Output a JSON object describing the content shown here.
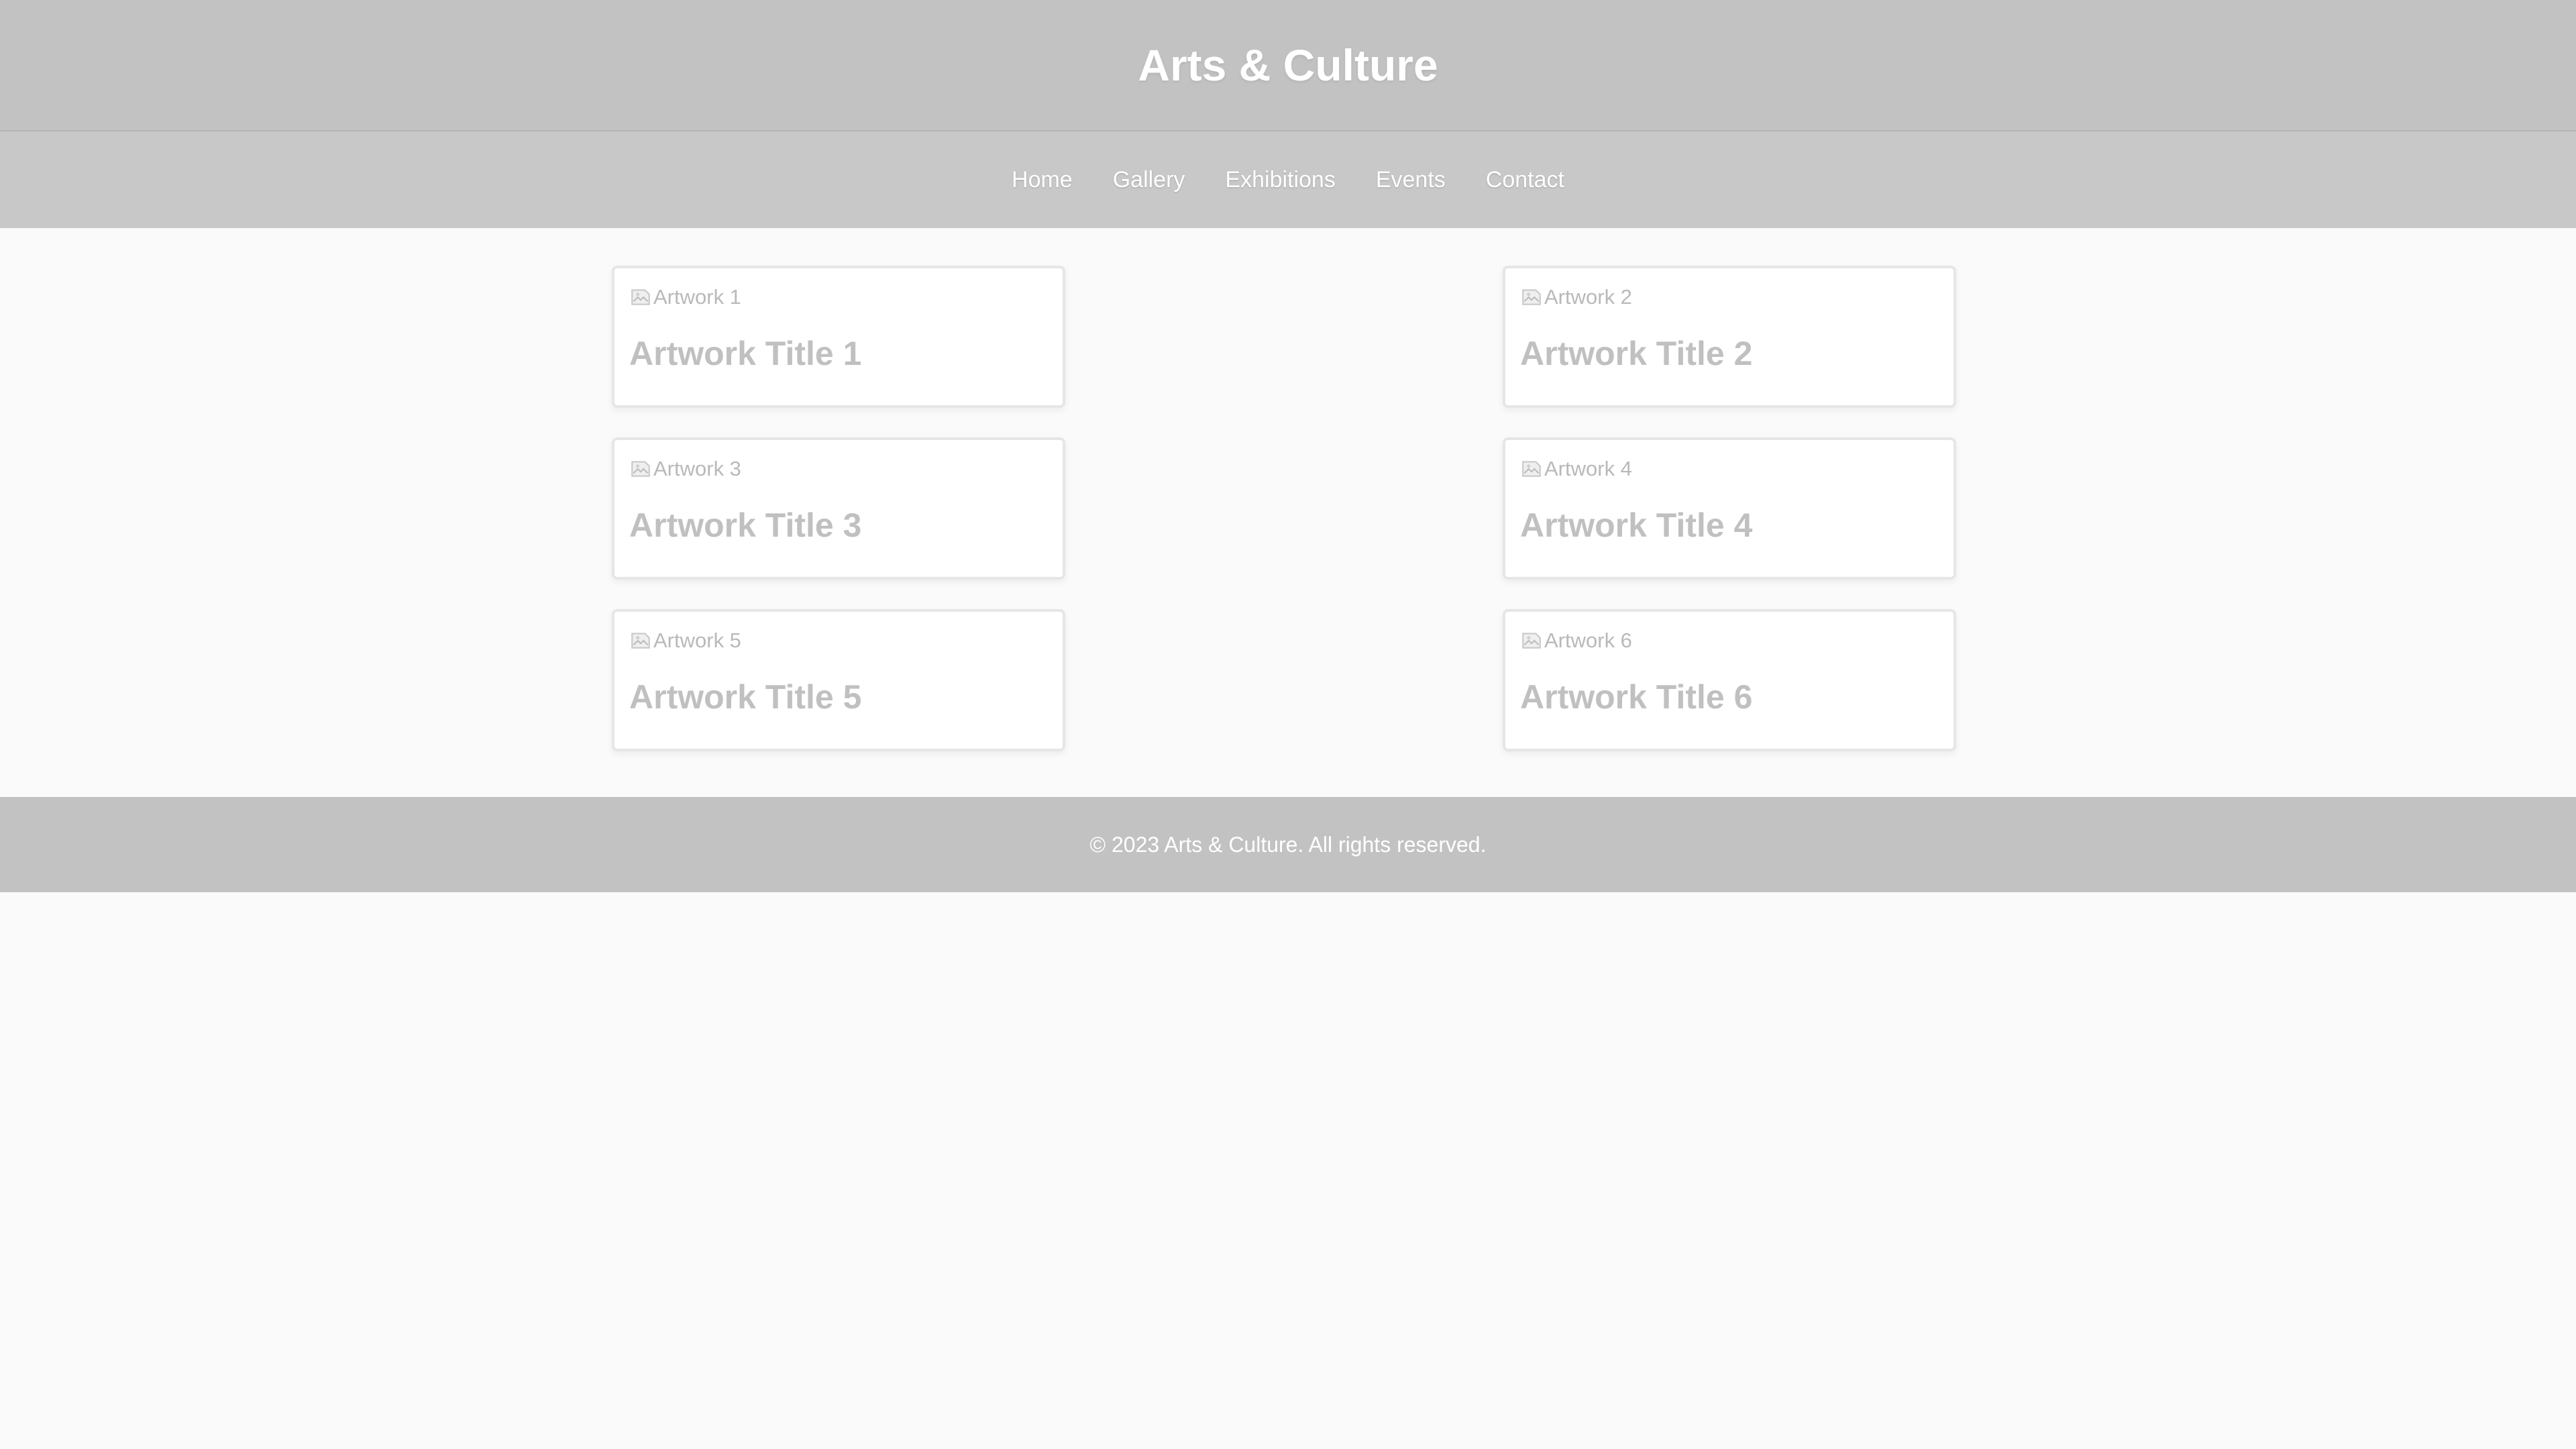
{
  "header": {
    "title": "Arts & Culture"
  },
  "nav": {
    "items": [
      {
        "label": "Home"
      },
      {
        "label": "Gallery"
      },
      {
        "label": "Exhibitions"
      },
      {
        "label": "Events"
      },
      {
        "label": "Contact"
      }
    ]
  },
  "gallery": {
    "cards": [
      {
        "image_alt": "Artwork 1",
        "title": "Artwork Title 1"
      },
      {
        "image_alt": "Artwork 2",
        "title": "Artwork Title 2"
      },
      {
        "image_alt": "Artwork 3",
        "title": "Artwork Title 3"
      },
      {
        "image_alt": "Artwork 4",
        "title": "Artwork Title 4"
      },
      {
        "image_alt": "Artwork 5",
        "title": "Artwork Title 5"
      },
      {
        "image_alt": "Artwork 6",
        "title": "Artwork Title 6"
      }
    ]
  },
  "footer": {
    "copyright": "© 2023 Arts & Culture. All rights reserved."
  },
  "colors": {
    "header_bg": "#c2c2c2",
    "nav_bg": "#c8c8c8",
    "page_bg": "#fafafa",
    "card_text": "#c0c0c0",
    "header_text": "#ffffff"
  },
  "icons": {
    "card_image": "broken-image-icon"
  }
}
